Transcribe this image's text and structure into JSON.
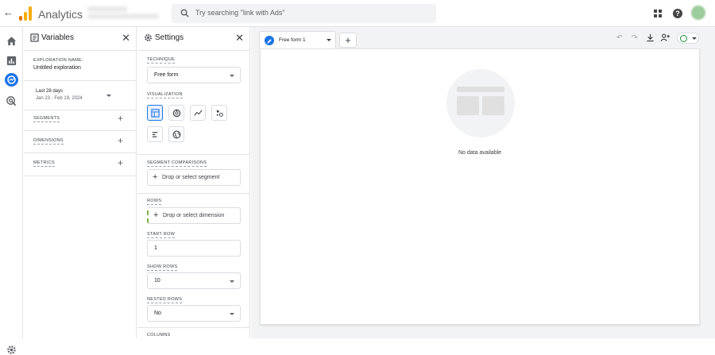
{
  "header": {
    "app_title": "Analytics",
    "search_placeholder": "Try searching \"link with Ads\""
  },
  "variables": {
    "title": "Variables",
    "exploration_name_label": "EXPLORATION NAME:",
    "exploration_name": "Untitled exploration",
    "date_range_label": "Last 28 days",
    "date_range": "Jan 23 - Feb 19, 2024",
    "segments_label": "SEGMENTS",
    "dimensions_label": "DIMENSIONS",
    "metrics_label": "METRICS"
  },
  "settings": {
    "title": "Settings",
    "technique_label": "TECHNIQUE",
    "technique_value": "Free form",
    "visualization_label": "VISUALIZATION",
    "segment_comparisons_label": "SEGMENT COMPARISONS",
    "segment_drop": "Drop or select segment",
    "rows_label": "ROWS",
    "rows_drop": "Drop or select dimension",
    "start_row_label": "START ROW",
    "start_row_value": "1",
    "show_rows_label": "SHOW ROWS",
    "show_rows_value": "10",
    "nested_rows_label": "NESTED ROWS",
    "nested_rows_value": "No",
    "columns_label": "COLUMNS"
  },
  "canvas": {
    "tab_name": "Free form 1",
    "no_data": "No data available"
  },
  "colors": {
    "accent": "#1a73e8",
    "canvas_bg": "#f1f3f4",
    "ok_green": "#1e8e3e"
  }
}
